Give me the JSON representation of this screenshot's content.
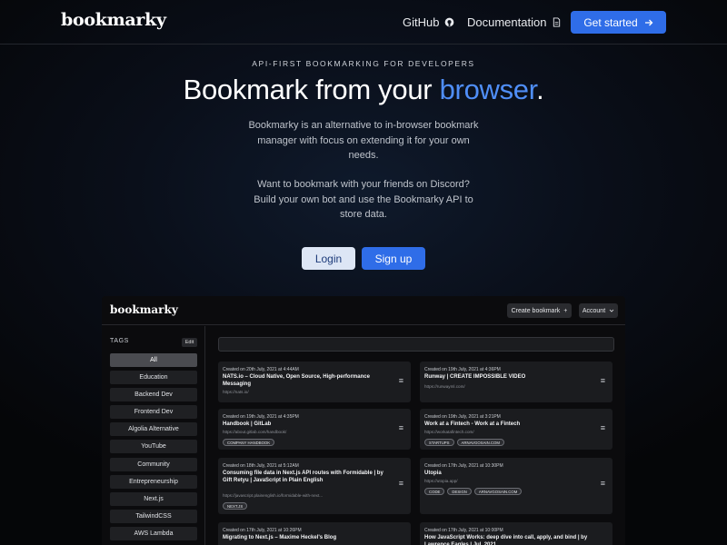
{
  "nav": {
    "brand": "bookmarky",
    "github_label": "GitHub",
    "docs_label": "Documentation",
    "cta_label": "Get started"
  },
  "hero": {
    "eyebrow": "API-FIRST BOOKMARKING FOR DEVELOPERS",
    "headline_pre": "Bookmark from your ",
    "headline_accent": "browser",
    "headline_post": ".",
    "paragraph1": "Bookmarky is an alternative to in-browser bookmark manager with focus on extending it for your own needs.",
    "paragraph2": "Want to bookmark with your friends on Discord? Build your own bot and use the Bookmarky API to store data.",
    "login_label": "Login",
    "signup_label": "Sign up"
  },
  "colors": {
    "accent": "#4f8ef7",
    "primary_button": "#2f6de8",
    "background": "#050608"
  },
  "app": {
    "brand": "bookmarky",
    "create_label": "Create bookmark",
    "account_label": "Account",
    "tags_title": "TAGS",
    "edit_label": "Edit",
    "tags": [
      "All",
      "Education",
      "Backend Dev",
      "Frontend Dev",
      "Algolia Alternative",
      "YouTube",
      "Community",
      "Entrepreneurship",
      "Next.js",
      "TailwindCSS",
      "AWS Lambda"
    ],
    "cards": [
      {
        "date": "Created on 20th July, 2021 at 4:44AM",
        "title": "NATS.io – Cloud Native, Open Source, High-performance Messaging",
        "url": "https://nats.io/",
        "tags": []
      },
      {
        "date": "Created on 19th July, 2021 at 4:36PM",
        "title": "Runway | CREATE IMPOSSIBLE VIDEO",
        "url": "https://runwayml.com/",
        "tags": []
      },
      {
        "date": "Created on 19th July, 2021 at 4:35PM",
        "title": "Handbook | GitLab",
        "url": "https://about.gitlab.com/handbook/",
        "tags": [
          "COMPANY HANDBOOK"
        ]
      },
      {
        "date": "Created on 19th July, 2021 at 3:21PM",
        "title": "Work at a Fintech - Work at a Fintech",
        "url": "https://workatafintech.com/",
        "tags": [
          "STARTUPS",
          "ARNAVGOSAIN.COM"
        ]
      },
      {
        "date": "Created on 18th July, 2021 at 5:12AM",
        "title": "Consuming file data in Next.js API routes with Formidable | by Gift Retyu | JavaScript in Plain English",
        "url": "https://javascript.plainenglish.io/formidable-with-next...",
        "tags": [
          "NEXT.JS"
        ]
      },
      {
        "date": "Created on 17th July, 2021 at 10:30PM",
        "title": "Utopia",
        "url": "https://utopia.app/",
        "tags": [
          "CODE",
          "DESIGN",
          "ARNAVGOSAIN.COM"
        ]
      },
      {
        "date": "Created on 17th July, 2021 at 10:26PM",
        "title": "Migrating to Next.js – Maxime Heckel's Blog",
        "url": "",
        "tags": []
      },
      {
        "date": "Created on 17th July, 2021 at 10:00PM",
        "title": "How JavaScript Works: deep dive into call, apply, and bind | by Lawrence Eagles | Jul, 2021",
        "url": "",
        "tags": []
      }
    ]
  }
}
